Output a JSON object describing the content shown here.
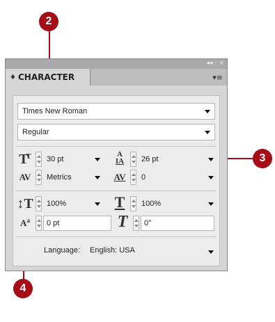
{
  "callouts": {
    "c2": "2",
    "c3": "3",
    "c4": "4"
  },
  "panel": {
    "tab_title": "CHARACTER",
    "tab_arrows": "♦",
    "collapse_glyph": "◂◂",
    "close_glyph": "×",
    "menu_glyph": "▾≡"
  },
  "font": {
    "family": "Times New Roman",
    "style": "Regular"
  },
  "fields": {
    "font_size": "30 pt",
    "leading": "26 pt",
    "kerning": "Metrics",
    "tracking": "0",
    "vertical_scale": "100%",
    "horizontal_scale": "100%",
    "baseline_shift": "0 pt",
    "skew": "0°"
  },
  "language": {
    "label": "Language:",
    "value": "English: USA"
  },
  "icons": {
    "font_size": "font-size-icon",
    "leading": "leading-icon",
    "kerning": "kerning-icon",
    "tracking": "tracking-icon",
    "vertical_scale": "vertical-scale-icon",
    "horizontal_scale": "horizontal-scale-icon",
    "baseline_shift": "baseline-shift-icon",
    "skew": "skew-icon"
  },
  "colors": {
    "callout": "#a40d18",
    "panel": "#d6d6d6",
    "titlebar": "#a9a9a9"
  }
}
